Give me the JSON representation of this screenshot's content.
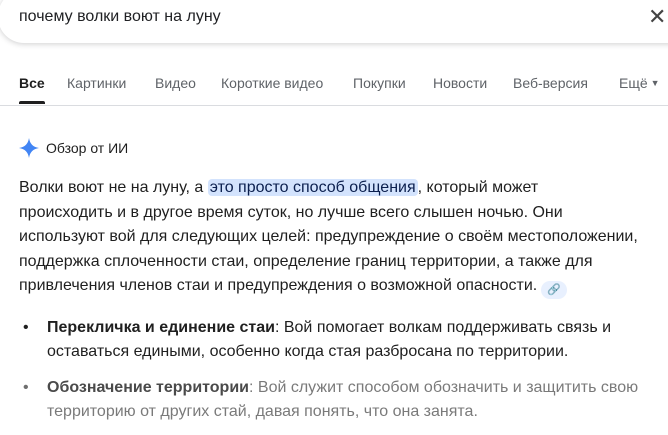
{
  "search": {
    "query": "почему волки воют на луну",
    "clear_icon": "close-icon"
  },
  "tabs": [
    {
      "label": "Все",
      "active": true
    },
    {
      "label": "Картинки"
    },
    {
      "label": "Видео"
    },
    {
      "label": "Короткие видео"
    },
    {
      "label": "Покупки"
    },
    {
      "label": "Новости"
    },
    {
      "label": "Веб-версия"
    },
    {
      "label": "Ещё"
    }
  ],
  "ai_overview": {
    "title": "Обзор от ИИ",
    "accent": "#4285f4",
    "line1_pre": "Волки воют не на луну, а ",
    "line1_highlight": "это просто способ общения",
    "line1_post": ", который может",
    "lines": [
      "происходить и в другое время суток, но лучше всего слышен ночью. Они",
      "используют вой для следующих целей: предупреждение о своём местоположении,",
      "поддержка сплоченности стаи, определение границ территории, а также для",
      "привлечения членов стаи и предупреждения о возможной опасности."
    ],
    "bullets": [
      {
        "title": "Перекличка и единение стаи",
        "text": ": Вой помогает волкам поддерживать связь и оставаться едиными, особенно когда стая разбросана по территории."
      },
      {
        "title": "Обозначение территории",
        "text": ": Вой служит способом обозначить и защитить свою территорию от других стай, давая понять, что она занята."
      }
    ]
  }
}
